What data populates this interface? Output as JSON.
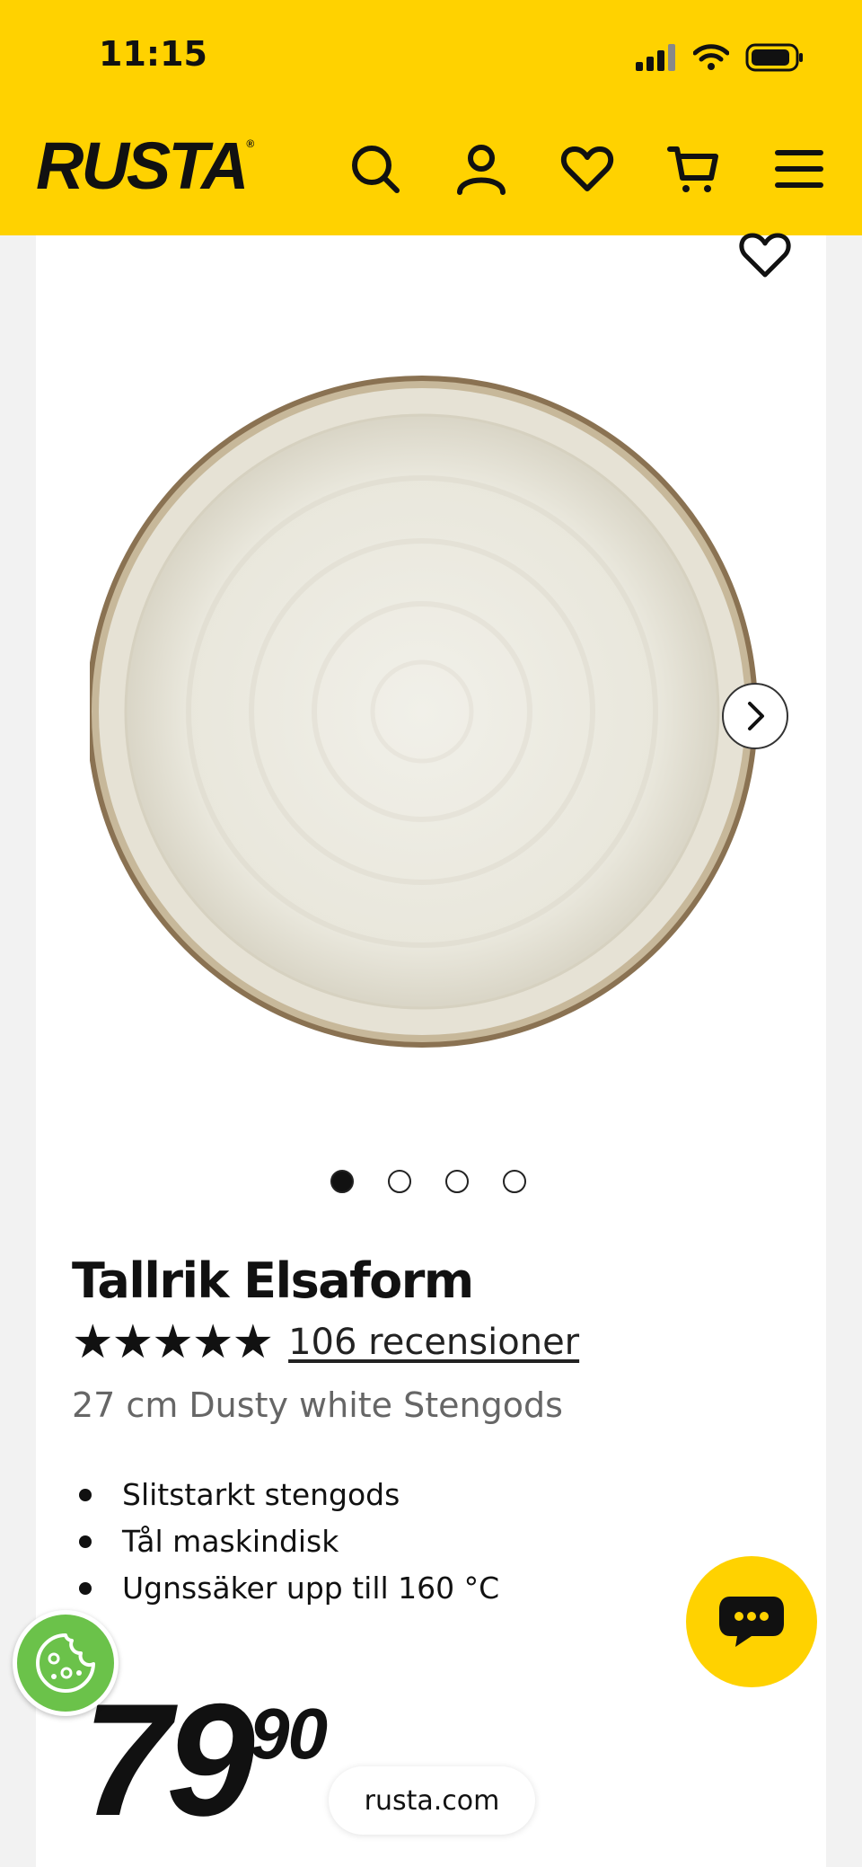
{
  "status_bar": {
    "time": "11:15"
  },
  "header": {
    "logo": "RUSTA",
    "logo_mark": "®",
    "background": "#ffd200",
    "icons": [
      "search-icon",
      "account-icon",
      "heart-icon",
      "cart-icon",
      "menu-icon"
    ]
  },
  "product": {
    "title": "Tallrik Elsaform",
    "stars": "★★★★★",
    "rating": 5,
    "reviews_label": "106 recensioner",
    "subtitle": "27 cm Dusty white Stengods",
    "features": [
      "Slitstarkt stengods",
      "Tål maskindisk",
      "Ugnssäker upp till 160 °C"
    ],
    "price_int": "79",
    "price_dec": "90",
    "gallery": {
      "current": 1,
      "total": 4
    }
  },
  "browser": {
    "url": "rusta.com"
  },
  "colors": {
    "accent": "#ffd200",
    "cookie": "#6bc24a"
  }
}
